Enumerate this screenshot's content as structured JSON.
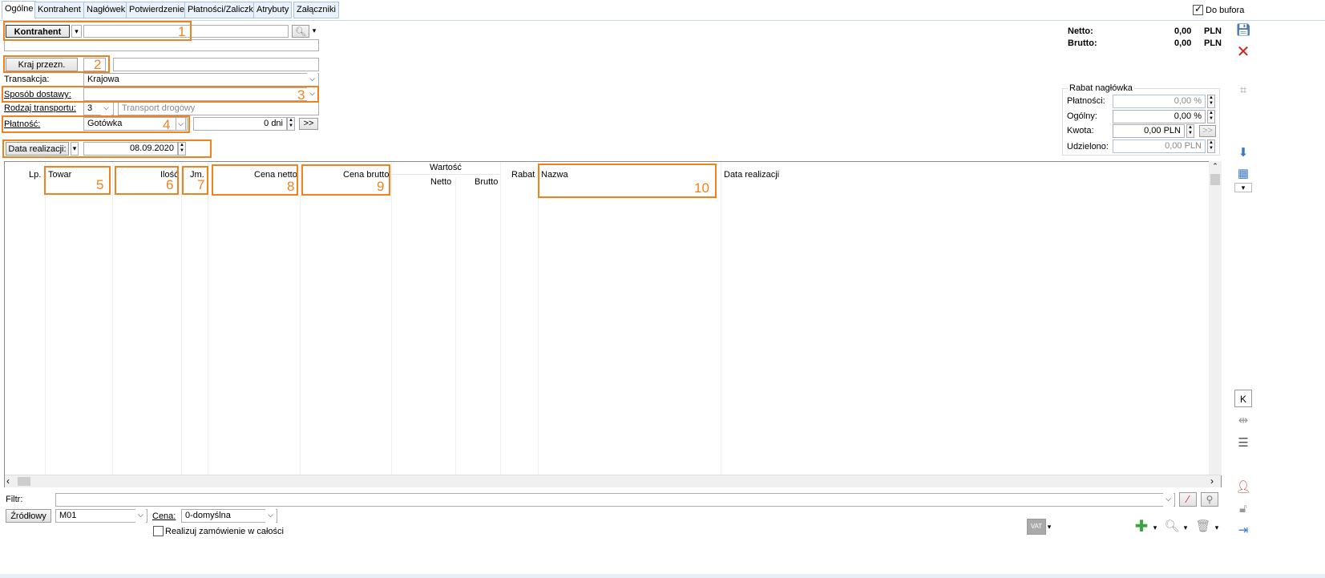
{
  "tabs": [
    "Ogólne",
    "Kontrahent",
    "Nagłówek",
    "Potwierdzenie",
    "Płatności/Zaliczki",
    "Atrybuty",
    "Załączniki"
  ],
  "do_bufora": {
    "label": "Do bufora",
    "checked": true
  },
  "header": {
    "kontrahent_button": "Kontrahent",
    "kontrahent_value": "",
    "kraj_button": "Kraj przezn.",
    "kraj_value": "",
    "transakcja_label": "Transakcja:",
    "transakcja_value": "Krajowa",
    "sposob_label": "Sposób dostawy:",
    "sposob_value": "",
    "rodzaj_label": "Rodzaj transportu:",
    "rodzaj_code": "3",
    "rodzaj_value": "Transport drogowy",
    "platnosc_label": "Płatność:",
    "platnosc_value": "Gotówka",
    "dni_value": "0 dni",
    "more_label": ">>",
    "data_button": "Data realizacji:",
    "data_value": "08.09.2020"
  },
  "totals": {
    "netto_label": "Netto:",
    "netto_value": "0,00",
    "netto_cur": "PLN",
    "brutto_label": "Brutto:",
    "brutto_value": "0,00",
    "brutto_cur": "PLN"
  },
  "rabat": {
    "title": "Rabat nagłówka",
    "platnosci_label": "Płatności:",
    "platnosci_value": "0,00 %",
    "ogolny_label": "Ogólny:",
    "ogolny_value": "0,00 %",
    "kwota_label": "Kwota:",
    "kwota_value": "0,00 PLN",
    "kwota_more": ">>",
    "udzielono_label": "Udzielono:",
    "udzielono_value": "0,00 PLN"
  },
  "table": {
    "lp": "Lp.",
    "towar": "Towar",
    "ilosc": "Ilość",
    "jm": "Jm.",
    "cena_netto": "Cena netto",
    "cena_brutto": "Cena brutto",
    "wartosc": "Wartość",
    "netto": "Netto",
    "brutto": "Brutto",
    "rabat": "Rabat",
    "nazwa": "Nazwa",
    "data_realizacji": "Data realizacji"
  },
  "annotations": [
    "1",
    "2",
    "3",
    "4",
    "5",
    "6",
    "7",
    "8",
    "9",
    "10"
  ],
  "footer": {
    "filtr_label": "Filtr:",
    "filtr_value": "",
    "zrodlowy_button": "Źródłowy",
    "magazyn_value": "M01",
    "cena_label": "Cena:",
    "cena_value": "0-domyślna",
    "realizuj_label": "Realizuj zamówienie w całości",
    "realizuj_checked": false,
    "vat_label": "VAT"
  },
  "colors": {
    "annotation": "#f0821e",
    "tab_border": "#a9c4e0"
  }
}
